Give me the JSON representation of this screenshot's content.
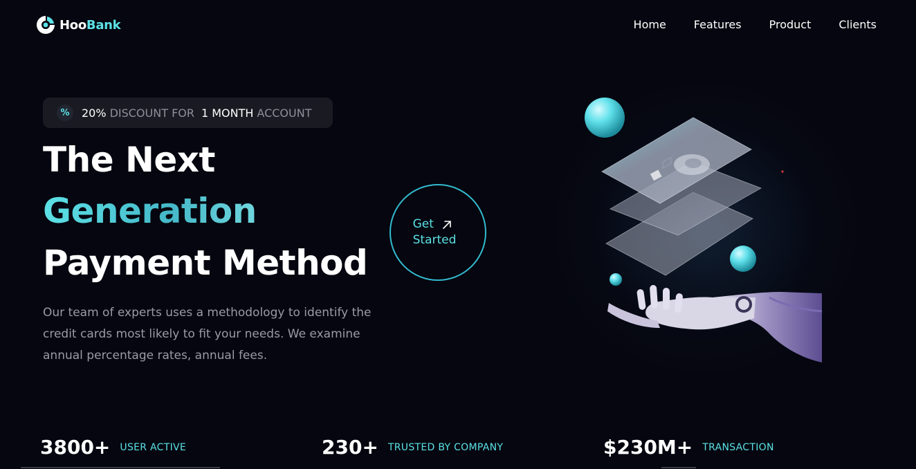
{
  "brand": {
    "name_part1": "Hoo",
    "name_part2": "Bank",
    "accent_color": "#5ce1e6"
  },
  "nav": {
    "items": [
      {
        "label": "Home"
      },
      {
        "label": "Features"
      },
      {
        "label": "Product"
      },
      {
        "label": "Clients"
      }
    ]
  },
  "badge": {
    "icon": "discount-percent-icon",
    "value": "20%",
    "text1": "DISCOUNT FOR",
    "period": "1 MONTH",
    "text2": "ACCOUNT"
  },
  "hero": {
    "line1": "The Next",
    "line2": "Generation",
    "line3": "Payment Method",
    "description": "Our team of experts uses a methodology to identify the credit cards most likely to fit your needs. We examine annual percentage rates, annual fees."
  },
  "cta": {
    "line1": "Get",
    "line2": "Started",
    "icon": "arrow-up-right-icon"
  },
  "stats": [
    {
      "value": "3800+",
      "label": "USER ACTIVE"
    },
    {
      "value": "230+",
      "label": "TRUSTED BY COMPANY"
    },
    {
      "value": "$230M+",
      "label": "TRANSACTION"
    }
  ]
}
